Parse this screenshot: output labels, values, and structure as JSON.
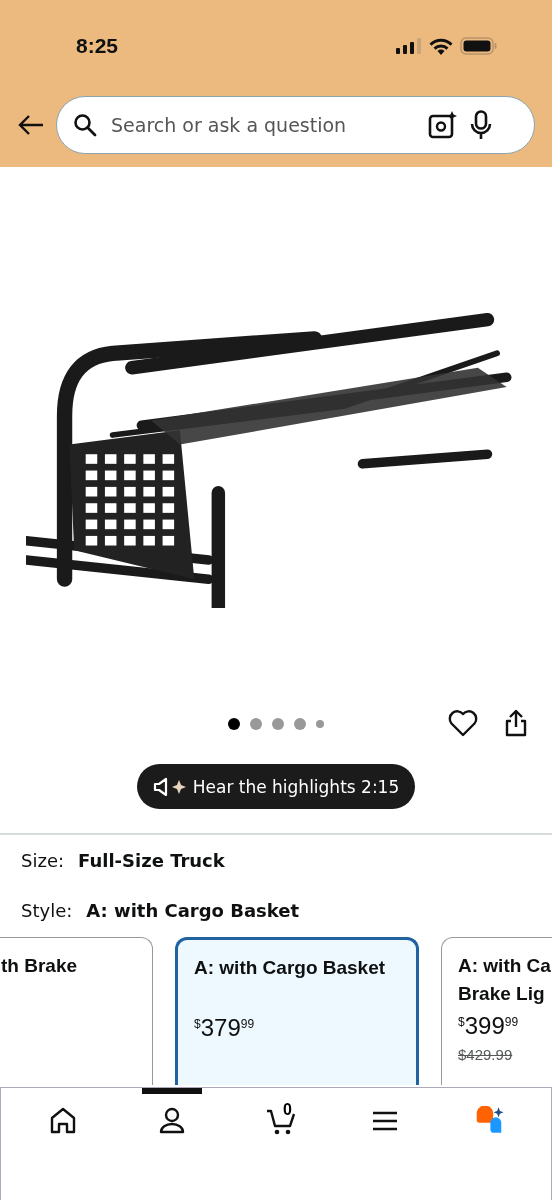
{
  "status_bar": {
    "time": "8:25"
  },
  "search": {
    "placeholder": "Search or ask a question"
  },
  "gallery": {
    "dots": [
      {
        "selected": true
      },
      {
        "selected": false
      },
      {
        "selected": false
      },
      {
        "selected": false
      },
      {
        "selected": false,
        "small": true
      }
    ]
  },
  "audio_button": {
    "label": "Hear the highlights 2:15"
  },
  "size": {
    "label": "Size:",
    "value": "Full-Size Truck"
  },
  "style": {
    "label": "Style:",
    "value": "A: with Cargo Basket"
  },
  "options": [
    {
      "title_lines": [
        "th Brake"
      ],
      "selected": false
    },
    {
      "title_lines": [
        "A: with Cargo Basket"
      ],
      "selected": true,
      "price": {
        "symbol": "$",
        "whole": "379",
        "fraction": "99"
      }
    },
    {
      "title_lines": [
        "A: with Ca",
        "Brake Lig"
      ],
      "selected": false,
      "price": {
        "symbol": "$",
        "whole": "399",
        "fraction": "99"
      },
      "list_price": "$429.99"
    }
  ],
  "bottom_nav": [
    {
      "kind": "home",
      "selected": false
    },
    {
      "kind": "account",
      "selected": true
    },
    {
      "kind": "cart",
      "selected": false,
      "count": "0"
    },
    {
      "kind": "menu",
      "selected": false
    },
    {
      "kind": "assistant",
      "selected": false
    }
  ]
}
